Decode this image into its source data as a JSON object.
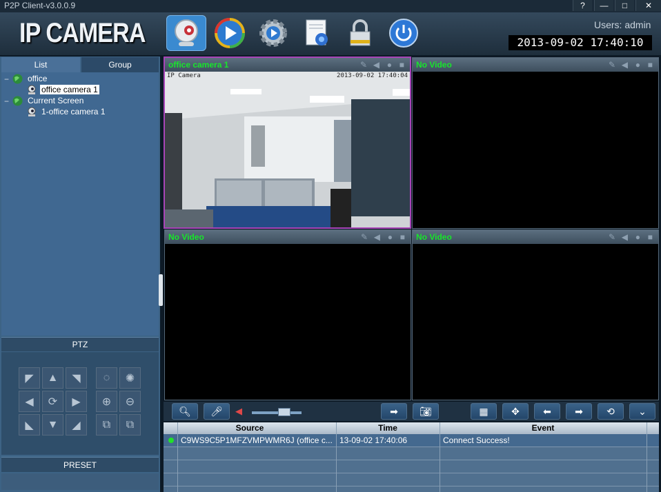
{
  "window": {
    "title": "P2P Client-v3.0.0.9",
    "help": "?",
    "minimize": "—",
    "maximize": "□",
    "close": "✕"
  },
  "header": {
    "logo": "IP CAMERA",
    "users_label": "Users: admin",
    "datetime": "2013-09-02  17:40:10"
  },
  "toolbar": [
    "camera-icon",
    "playback-icon",
    "settings-icon",
    "log-icon",
    "lock-icon",
    "power-icon"
  ],
  "left_tabs": {
    "list": "List",
    "group": "Group"
  },
  "tree": {
    "group1": "office",
    "group1_camera": "office camera 1",
    "group2": "Current Screen",
    "group2_camera": "1-office camera 1"
  },
  "ptz": {
    "label": "PTZ"
  },
  "preset": {
    "label": "PRESET"
  },
  "panes": [
    {
      "title": "office camera 1",
      "overlay_label": "IP Camera",
      "overlay_time": "2013-09-02 17:40:04"
    },
    {
      "title": "No Video"
    },
    {
      "title": "No Video"
    },
    {
      "title": "No Video"
    }
  ],
  "volume": {
    "level": 0.65
  },
  "log": {
    "columns": {
      "source": "Source",
      "time": "Time",
      "event": "Event"
    },
    "rows": [
      {
        "source": "C9WS9C5P1MFZVMPWMR6J (office c...",
        "time": "13-09-02 17:40:06",
        "event": "Connect Success!",
        "status_color": "#22e02a"
      }
    ]
  },
  "colors": {
    "accent": "#3a8ad0",
    "active_pane_border": "#a844b8",
    "pane_title": "#18e62b"
  }
}
